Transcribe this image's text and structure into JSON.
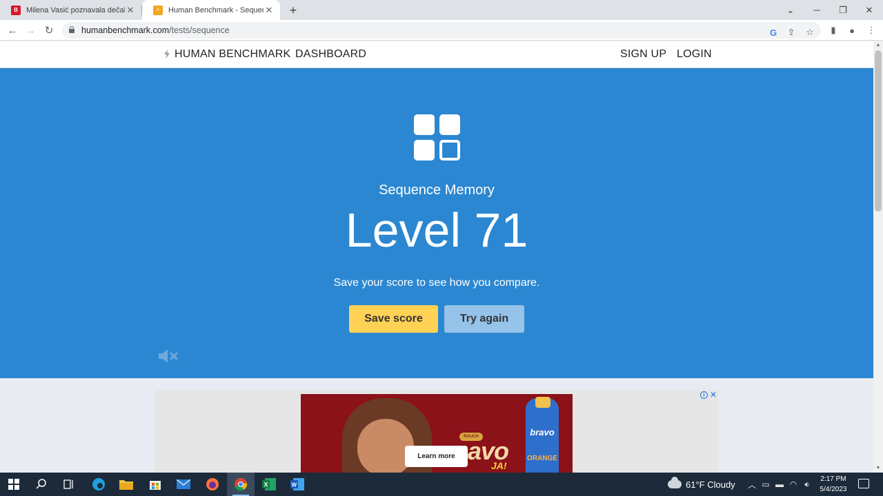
{
  "browser": {
    "tabs": [
      {
        "title": "Milena Vasić poznavala dečaka k",
        "active": false,
        "favicon": "blic-favicon"
      },
      {
        "title": "Human Benchmark - Sequence M",
        "active": true,
        "favicon": "bolt-favicon"
      }
    ],
    "new_tab_label": "+",
    "address": {
      "host": "humanbenchmark.com",
      "path": "/tests/sequence"
    }
  },
  "site": {
    "brand": "HUMAN BENCHMARK",
    "nav": {
      "dashboard": "DASHBOARD",
      "signup": "SIGN UP",
      "login": "LOGIN"
    }
  },
  "hero": {
    "test_name": "Sequence Memory",
    "level_text": "Level 71",
    "message": "Save your score to see how you compare.",
    "save_button": "Save score",
    "try_button": "Try again",
    "icon": "sequence-grid-icon",
    "background_color": "#2b87d1"
  },
  "ad": {
    "cta": "Learn more",
    "brand_text": "avo",
    "tag": "RAUCH",
    "bottle_brand": "bravo",
    "bottle_flavor": "ORANGE",
    "badge": "JA!"
  },
  "taskbar": {
    "weather": "61°F  Cloudy",
    "time": "2:17 PM",
    "date": "5/4/2023"
  }
}
